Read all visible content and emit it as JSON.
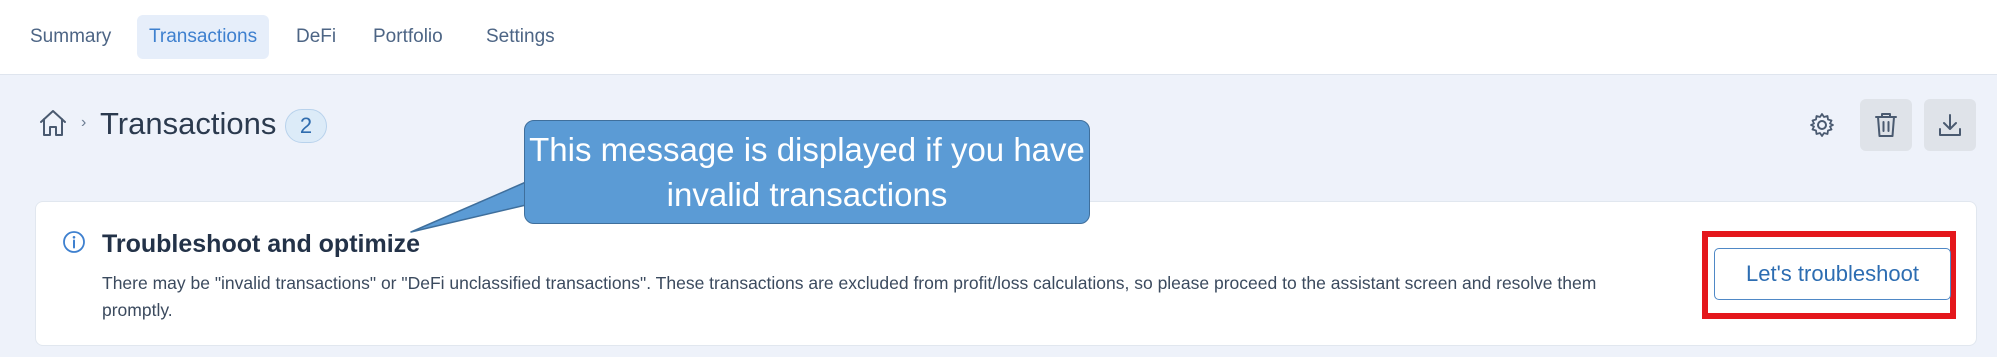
{
  "nav": {
    "tabs": [
      {
        "label": "Summary",
        "active": false
      },
      {
        "label": "Transactions",
        "active": true
      },
      {
        "label": "DeFi",
        "active": false
      },
      {
        "label": "Portfolio",
        "active": false
      },
      {
        "label": "Settings",
        "active": false
      }
    ]
  },
  "header": {
    "title": "Transactions",
    "count": "2",
    "actions": [
      "gear-icon",
      "trash-icon",
      "download-icon"
    ]
  },
  "notice": {
    "title": "Troubleshoot and optimize",
    "description": "There may be \"invalid transactions\" or \"DeFi unclassified transactions\". These transactions are excluded from profit/loss calculations, so please proceed to the assistant screen and resolve them promptly.",
    "button_label": "Let's troubleshoot"
  },
  "annotation": {
    "callout_text": "This message is displayed if you have invalid transactions"
  },
  "colors": {
    "accent": "#3e80cf",
    "highlight_border": "#e4171c",
    "callout_fill": "#5b9bd5"
  }
}
